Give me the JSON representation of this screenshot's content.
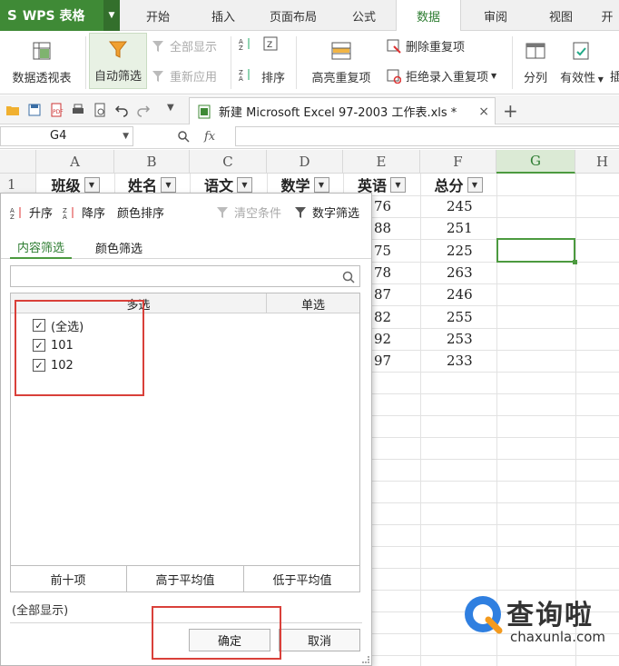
{
  "app": {
    "name": "WPS 表格"
  },
  "tabs": [
    "开始",
    "插入",
    "页面布局",
    "公式",
    "数据",
    "审阅",
    "视图",
    "开"
  ],
  "active_tab": "数据",
  "ribbon": {
    "pivot": "数据透视表",
    "autofilter": "自动筛选",
    "show_all": "全部显示",
    "reapply": "重新应用",
    "sort": "排序",
    "highlight_dup": "高亮重复项",
    "delete_dup": "删除重复项",
    "reject_dup": "拒绝录入重复项",
    "split": "分列",
    "validity": "有效性",
    "more": "插"
  },
  "document_tab": {
    "title": "新建 Microsoft Excel 97-2003 工作表.xls *",
    "close": "×",
    "new": "+"
  },
  "formula_bar": {
    "cell_ref": "G4",
    "fx": "fx",
    "value": ""
  },
  "grid": {
    "columns": [
      "A",
      "B",
      "C",
      "D",
      "E",
      "F",
      "G",
      "H"
    ],
    "selected_column": "G",
    "rows": [
      "1"
    ],
    "headers": [
      "班级",
      "姓名",
      "语文",
      "数学",
      "英语",
      "总分"
    ],
    "english": [
      "76",
      "88",
      "75",
      "78",
      "87",
      "82",
      "92",
      "97"
    ],
    "total": [
      "245",
      "251",
      "225",
      "263",
      "246",
      "255",
      "253",
      "233"
    ]
  },
  "filter_popup": {
    "sort_asc": "升序",
    "sort_desc": "降序",
    "color_sort": "颜色排序",
    "clear": "清空条件",
    "number_filter": "数字筛选",
    "tab_content": "内容筛选",
    "tab_color": "颜色筛选",
    "search_placeholder": "",
    "col_multi": "多选",
    "col_single": "单选",
    "items": [
      {
        "label": "(全选)",
        "checked": true
      },
      {
        "label": "101",
        "checked": true
      },
      {
        "label": "102",
        "checked": true
      }
    ],
    "presets": [
      "前十项",
      "高于平均值",
      "低于平均值"
    ],
    "show_all": "(全部显示)",
    "ok": "确定",
    "cancel": "取消"
  },
  "watermark": {
    "brand": "查询啦",
    "url": "chaxunla.com"
  },
  "colors": {
    "accent": "#4c9a3f",
    "app_green": "#3f8a36",
    "annotation_red": "#d9403a"
  }
}
